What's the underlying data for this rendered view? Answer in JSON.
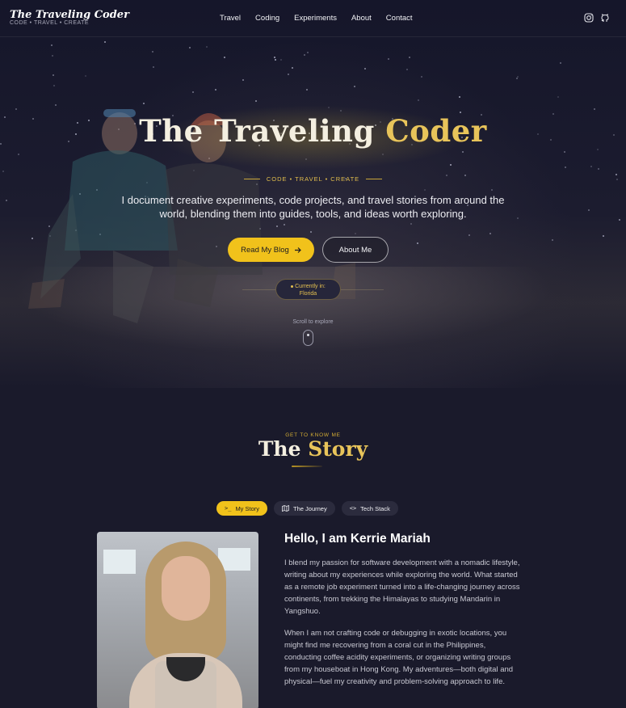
{
  "brand": {
    "title": "The Traveling Coder",
    "tagline": "CODE • TRAVEL • CREATE"
  },
  "nav": {
    "links": [
      "Travel",
      "Coding",
      "Experiments",
      "About",
      "Contact"
    ],
    "icons": [
      "instagram-icon",
      "github-icon"
    ]
  },
  "hero": {
    "title_part1": "The Traveling ",
    "title_part2": "Coder",
    "tagline": "CODE • TRAVEL • CREATE",
    "description": "I document creative experiments, code projects, and travel stories from around the world, blending them into guides, tools, and ideas worth exploring.",
    "primary_button": "Read My Blog",
    "secondary_button": "About Me",
    "location_label": "Currently in:",
    "location_value": "Florida",
    "scroll_label": "Scroll to explore"
  },
  "story": {
    "eyebrow": "GET TO KNOW ME",
    "title_part1": "The ",
    "title_part2": "Story",
    "tabs": [
      {
        "label": "My Story",
        "icon": ">_",
        "active": true
      },
      {
        "label": "The Journey",
        "icon": "map",
        "active": false
      },
      {
        "label": "Tech Stack",
        "icon": "<>",
        "active": false
      }
    ],
    "heading": "Hello, I am Kerrie Mariah",
    "paragraph1": "I blend my passion for software development with a nomadic lifestyle, writing about my experiences while exploring the world. What started as a remote job experiment turned into a life-changing journey across continents, from trekking the Himalayas to studying Mandarin in Yangshuo.",
    "paragraph2": "When I am not crafting code or debugging in exotic locations, you might find me recovering from a coral cut in the Philippines, conducting coffee acidity experiments, or organizing writing groups from my houseboat in Hong Kong. My adventures—both digital and physical—fuel my creativity and problem-solving approach to life."
  },
  "colors": {
    "accent": "#f1c21b",
    "background": "#1a1a2b",
    "gold_text": "#e8c45a"
  }
}
